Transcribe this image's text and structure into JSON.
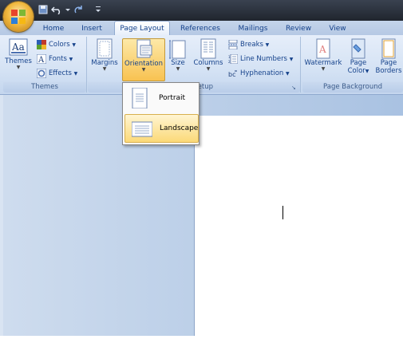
{
  "tabs": [
    "Home",
    "Insert",
    "Page Layout",
    "References",
    "Mailings",
    "Review",
    "View"
  ],
  "active_tab": "Page Layout",
  "ribbon": {
    "themes_group": {
      "label": "Themes",
      "themes_button": "Themes",
      "colors": "Colors",
      "fonts": "Fonts",
      "effects": "Effects"
    },
    "page_setup_group": {
      "label": "Page Setup",
      "margins": "Margins",
      "orientation": "Orientation",
      "size": "Size",
      "columns": "Columns",
      "breaks": "Breaks",
      "line_numbers": "Line Numbers",
      "hyphenation": "Hyphenation"
    },
    "page_background_group": {
      "label": "Page Background",
      "watermark": "Watermark",
      "page_color_1": "Page",
      "page_color_2": "Color",
      "page_borders_1": "Page",
      "page_borders_2": "Borders"
    }
  },
  "orientation_menu": {
    "items": [
      "Portrait",
      "Landscape"
    ],
    "highlighted": "Landscape"
  },
  "colors": {
    "accent": "#f8c251",
    "ribbon": "#d4e2f4",
    "text": "#15428b"
  }
}
